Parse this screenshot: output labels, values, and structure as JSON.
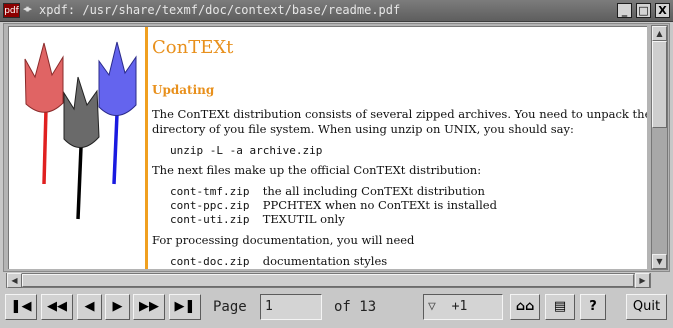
{
  "window": {
    "app_icon_label": "pdf",
    "title": "xpdf: /usr/share/texmf/doc/context/base/readme.pdf",
    "controls": {
      "minimize": "_",
      "maximize": "□",
      "close": "X"
    }
  },
  "document": {
    "title": "ConTEXt",
    "section_heading": "Updating",
    "p1_line1": "The ConTEXt distribution consists of several zipped archives. You need to unpack these in the",
    "p1_line2": "directory of you file system. When using unzip on UNIX, you should say:",
    "cmd": "unzip  -L  -a  archive.zip",
    "p2": "The next files make up the official ConTEXt distribution:",
    "files": [
      {
        "name": "cont-tmf.zip",
        "desc": "the all including ConTEXt distribution"
      },
      {
        "name": "cont-ppc.zip",
        "desc": "PPCHTEX when no ConTEXt is installed"
      },
      {
        "name": "cont-uti.zip",
        "desc": "TEXUTIL only"
      }
    ],
    "p3": "For processing documentation, you will need",
    "doc_file": {
      "name": "cont-doc.zip",
      "desc": "documentation styles"
    }
  },
  "toolbar": {
    "page_label": "Page",
    "page_value": "1",
    "of_label": "of 13",
    "zoom_value": "+1",
    "quit_label": "Quit",
    "buttons": [
      "first-page",
      "back-10-pages",
      "previous-page",
      "next-page",
      "forward-10-pages",
      "go-to-end",
      "zoom-select",
      "find",
      "print",
      "about"
    ]
  },
  "colors": {
    "accent": "#e8901c",
    "tulip_red": "#e05a5a",
    "tulip_gray": "#6a6a6a",
    "tulip_blue": "#5a5aee"
  }
}
